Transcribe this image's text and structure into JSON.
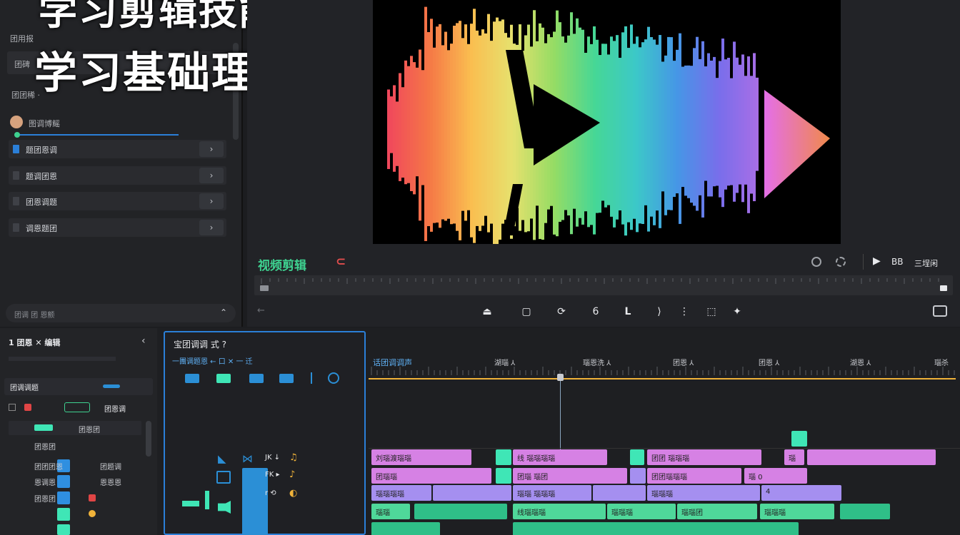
{
  "overlay": {
    "line1": "学习剪辑技能",
    "line2": "学习基础理论"
  },
  "left_panel": {
    "header": "团用报",
    "field": "团碑",
    "group": "团团稀 ·",
    "user_label": "图调博鳐",
    "items": [
      {
        "label": "题团恩调",
        "chev": "›"
      },
      {
        "label": "题调团恩",
        "chev": "›"
      },
      {
        "label": "团恩调题",
        "chev": "›"
      },
      {
        "label": "调恩题团",
        "chev": "›"
      }
    ],
    "footer_search": "团调 团 恩颤",
    "footer_icon": "⌃"
  },
  "viewer": {
    "title": "视频剪辑",
    "rec_icon": "⊂",
    "right_labels": [
      "BB",
      "三埕闲"
    ],
    "controls": [
      "⏏",
      "▢",
      "⟳",
      "6",
      "L",
      "⟩",
      "⋮",
      "⬚",
      "✦"
    ]
  },
  "tools_panel": {
    "header": "1 团恩 ✕ 编辑",
    "collapse": "‹",
    "section": "团调调题",
    "tag": "团恩调",
    "chip_label": "团恩团",
    "rows": [
      {
        "label": "团恩团",
        "color": "#3fe6b6"
      },
      {
        "label": "团团团恩",
        "color": "#2f8fe0"
      },
      {
        "label": "团题调",
        "color": "#2f8fe0"
      },
      {
        "label": "恩调恩",
        "color": "#2f8fe0"
      },
      {
        "label": "恩恩恩",
        "color": "#3fe6b6"
      },
      {
        "label": "团恩团",
        "color": "#3fe6b6"
      }
    ]
  },
  "effects_panel": {
    "title": "宝团调调 式 ?",
    "subtitle": "一團调题恩 ← 口 ✕ 一 迁",
    "track_labels": [
      "JK ↓",
      "FK ▸",
      "r ⟲"
    ]
  },
  "timeline": {
    "left_label": "话团调调声",
    "markers": [
      "湖瑙 ⅄",
      "瑙恩洗 ⅄",
      "团恩 ⅄",
      "团恩 ⅄",
      "湖恩 ⅄",
      "瑙杀"
    ],
    "row1": [
      "刘瑙渡瑙瑙",
      "线 瑙瑙瑙瑙",
      "团团 瑙瑙瑙",
      "瑙"
    ],
    "row2": [
      "团瑙瑙",
      "团瑙 瑙团",
      "团团瑙瑙瑙",
      "瑙 0"
    ],
    "row3": [
      "瑙瑙瑙瑙",
      "瑙瑙 瑙瑙瑙",
      "瑙瑙瑙",
      "4"
    ],
    "row4": [
      "瑙瑙",
      "线瑙瑙瑙",
      "瑙瑙瑙",
      "瑙瑙团",
      "瑙瑙瑙"
    ]
  },
  "colors": {
    "accent_green": "#3ed190",
    "accent_blue": "#2b7fd8",
    "playhead": "#f0b33a"
  }
}
